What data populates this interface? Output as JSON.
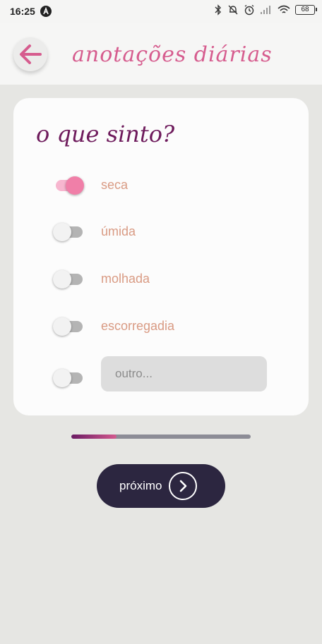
{
  "status_bar": {
    "time": "16:25",
    "battery": "68",
    "icons": [
      "app-icon",
      "bluetooth-icon",
      "mute-icon",
      "alarm-icon",
      "signal-icon",
      "wifi-icon",
      "battery-icon"
    ]
  },
  "app_bar": {
    "title": "anotações diárias",
    "back_icon": "arrow-left-icon"
  },
  "card": {
    "title": "o que sinto?",
    "options": [
      {
        "label": "seca",
        "checked": true
      },
      {
        "label": "úmida",
        "checked": false
      },
      {
        "label": "molhada",
        "checked": false
      },
      {
        "label": "escorregadia",
        "checked": false
      }
    ],
    "other": {
      "checked": false,
      "placeholder": "outro...",
      "value": ""
    }
  },
  "progress": {
    "value": 0.25
  },
  "next_button": {
    "label": "próximo",
    "icon": "chevron-right-icon"
  },
  "colors": {
    "accent_pink": "#d65c8e",
    "title_purple": "#6e1b5c",
    "toggle_on": "#f07fa8",
    "label": "#d99b84",
    "button_dark": "#2c2640"
  }
}
